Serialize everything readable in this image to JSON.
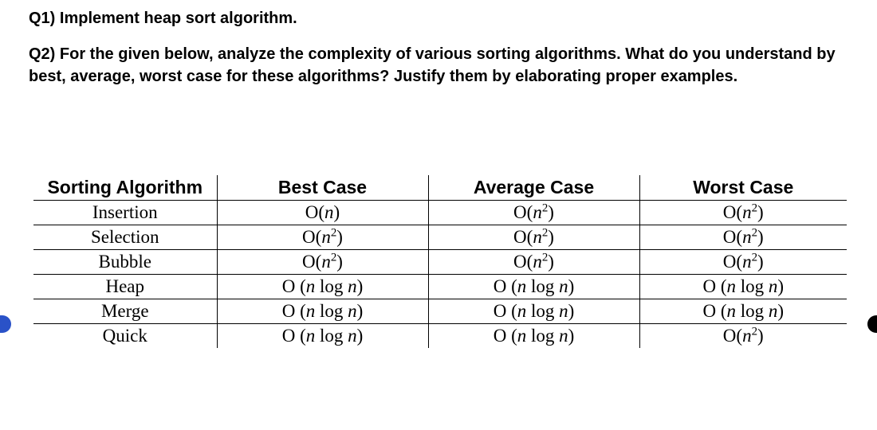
{
  "q1": "Q1) Implement heap sort algorithm.",
  "q2": "Q2) For the given below, analyze the complexity of various sorting algorithms. What do you understand by best, average, worst case for these algorithms? Justify them by elaborating proper examples.",
  "table": {
    "headers": [
      "Sorting Algorithm",
      "Best Case",
      "Average Case",
      "Worst Case"
    ],
    "rows": [
      {
        "alg": "Insertion",
        "best": "O(n)",
        "avg": "O(n²)",
        "worst": "O(n²)"
      },
      {
        "alg": "Selection",
        "best": "O(n²)",
        "avg": "O(n²)",
        "worst": "O(n²)"
      },
      {
        "alg": "Bubble",
        "best": "O(n²)",
        "avg": "O(n²)",
        "worst": "O(n²)"
      },
      {
        "alg": "Heap",
        "best": "O (n log n)",
        "avg": "O (n log n)",
        "worst": "O (n log n)"
      },
      {
        "alg": "Merge",
        "best": "O (n log n)",
        "avg": "O (n log n)",
        "worst": "O (n log n)"
      },
      {
        "alg": "Quick",
        "best": "O (n log n)",
        "avg": "O (n log n)",
        "worst": "O(n²)"
      }
    ]
  },
  "chart_data": {
    "type": "table",
    "title": "Sorting Algorithm Time Complexity",
    "columns": [
      "Sorting Algorithm",
      "Best Case",
      "Average Case",
      "Worst Case"
    ],
    "rows": [
      [
        "Insertion",
        "O(n)",
        "O(n^2)",
        "O(n^2)"
      ],
      [
        "Selection",
        "O(n^2)",
        "O(n^2)",
        "O(n^2)"
      ],
      [
        "Bubble",
        "O(n^2)",
        "O(n^2)",
        "O(n^2)"
      ],
      [
        "Heap",
        "O(n log n)",
        "O(n log n)",
        "O(n log n)"
      ],
      [
        "Merge",
        "O(n log n)",
        "O(n log n)",
        "O(n log n)"
      ],
      [
        "Quick",
        "O(n log n)",
        "O(n log n)",
        "O(n^2)"
      ]
    ]
  }
}
